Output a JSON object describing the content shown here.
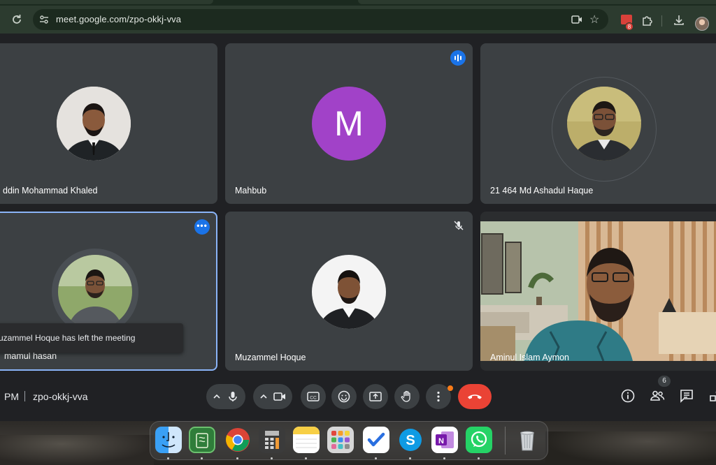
{
  "browser": {
    "url": "meet.google.com/zpo-okkj-vva",
    "extension_badge": "8",
    "icons": [
      "reload-icon",
      "site-settings-icon",
      "camera-icon",
      "star-icon",
      "extension-icon",
      "puzzle-icon",
      "download-icon",
      "profile-avatar"
    ]
  },
  "meeting": {
    "participants": [
      {
        "name": "ddin Mohammad Khaled"
      },
      {
        "name": "Mahbub",
        "initial": "M",
        "avatar_color": "#a142c8"
      },
      {
        "name": "21 464 Md Ashadul Haque"
      },
      {
        "name": "mamul hasan"
      },
      {
        "name": "Muzammel Hoque"
      },
      {
        "name": "Aminul Islam Aymon"
      }
    ],
    "toast": "uzammel Hoque has left the meeting"
  },
  "controls": {
    "time": "PM",
    "meeting_code": "zpo-okkj-vva",
    "people_count": "6",
    "end_call_color": "#ea4335",
    "accent_color": "#1a73e8"
  },
  "dock": {
    "apps": [
      "finder-icon",
      "quran-icon",
      "chrome-icon",
      "calculator-icon",
      "notes-icon",
      "launchpad-icon",
      "tasks-icon",
      "skype-icon",
      "onenote-icon",
      "whatsapp-icon",
      "trash-icon"
    ]
  }
}
